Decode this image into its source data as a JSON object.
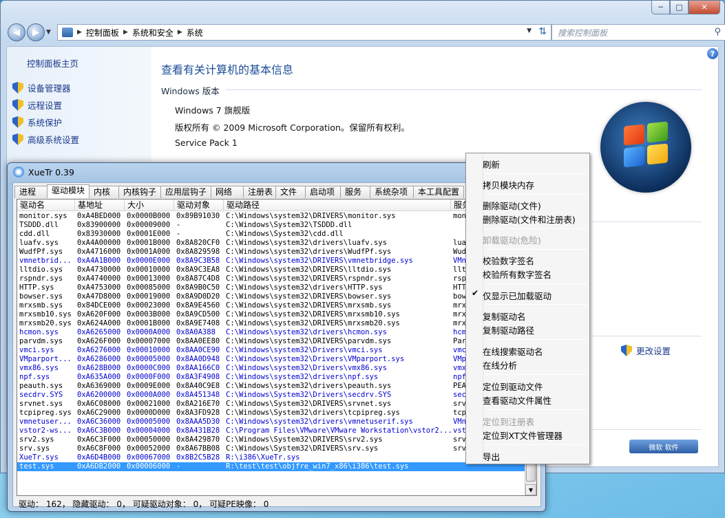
{
  "control_panel": {
    "address": {
      "crumbs": [
        "控制面板",
        "系统和安全",
        "系统"
      ]
    },
    "search_placeholder": "搜索控制面板",
    "sidebar": {
      "home": "控制面板主页",
      "items": [
        "设备管理器",
        "远程设置",
        "系统保护",
        "高级系统设置"
      ]
    },
    "title": "查看有关计算机的基本信息",
    "edition_heading": "Windows 版本",
    "edition": "Windows 7 旗舰版",
    "copyright": "版权所有 © 2009 Microsoft Corporation。保留所有权利。",
    "service_pack": "Service Pack 1",
    "change_settings": "更改设置",
    "genuine_badge": "微软 软件"
  },
  "xuetr": {
    "title": "XueTr 0.39",
    "tabs": [
      "进程",
      "驱动模块",
      "内核",
      "内核钩子",
      "应用层钩子",
      "网络",
      "注册表",
      "文件",
      "启动项",
      "服务",
      "系统杂项",
      "本工具配置"
    ],
    "active_tab": "驱动模块",
    "columns": [
      "驱动名",
      "基地址",
      "大小",
      "驱动对象",
      "驱动路径",
      "服务"
    ],
    "rows": [
      {
        "name": "monitor.sys",
        "base": "0xA4BED000",
        "size": "0x0000B000",
        "obj": "0x89B91030",
        "path": "C:\\Windows\\system32\\DRIVERS\\monitor.sys",
        "svc": "mon",
        "blue": false
      },
      {
        "name": "TSDDD.dll",
        "base": "0x83900000",
        "size": "0x00009000",
        "obj": "-",
        "path": "C:\\Windows\\System32\\TSDDD.dll",
        "svc": "",
        "blue": false
      },
      {
        "name": "cdd.dll",
        "base": "0x83930000",
        "size": "0x0001E000",
        "obj": "-",
        "path": "C:\\Windows\\System32\\cdd.dll",
        "svc": "",
        "blue": false
      },
      {
        "name": "luafv.sys",
        "base": "0xA4A00000",
        "size": "0x0001B000",
        "obj": "0x8A820CF0",
        "path": "C:\\Windows\\system32\\drivers\\luafv.sys",
        "svc": "lua",
        "blue": false
      },
      {
        "name": "WudfPf.sys",
        "base": "0xA4716000",
        "size": "0x0001A000",
        "obj": "0x8A829598",
        "path": "C:\\Windows\\system32\\drivers\\WudfPf.sys",
        "svc": "Wud",
        "blue": false
      },
      {
        "name": "vmnetbrid...",
        "base": "0xA4A1B000",
        "size": "0x0000E000",
        "obj": "0x8A9C3B58",
        "path": "C:\\Windows\\system32\\DRIVERS\\vmnetbridge.sys",
        "svc": "VMn",
        "blue": true
      },
      {
        "name": "lltdio.sys",
        "base": "0xA4730000",
        "size": "0x00010000",
        "obj": "0x8A9C3EA8",
        "path": "C:\\Windows\\system32\\DRIVERS\\lltdio.sys",
        "svc": "llt",
        "blue": false
      },
      {
        "name": "rspndr.sys",
        "base": "0xA4740000",
        "size": "0x00013000",
        "obj": "0x8A87C4D8",
        "path": "C:\\Windows\\system32\\DRIVERS\\rspndr.sys",
        "svc": "rsp",
        "blue": false
      },
      {
        "name": "HTTP.sys",
        "base": "0xA4753000",
        "size": "0x00085000",
        "obj": "0x8A9B0C50",
        "path": "C:\\Windows\\system32\\drivers\\HTTP.sys",
        "svc": "HTT",
        "blue": false
      },
      {
        "name": "bowser.sys",
        "base": "0xA47D8000",
        "size": "0x00019000",
        "obj": "0x8A9D0D20",
        "path": "C:\\Windows\\system32\\DRIVERS\\bowser.sys",
        "svc": "bow",
        "blue": false
      },
      {
        "name": "mrxsmb.sys",
        "base": "0x84DCE000",
        "size": "0x00023000",
        "obj": "0x8A9E4560",
        "path": "C:\\Windows\\system32\\DRIVERS\\mrxsmb.sys",
        "svc": "mrx",
        "blue": false
      },
      {
        "name": "mrxsmb10.sys",
        "base": "0xA620F000",
        "size": "0x0003B000",
        "obj": "0x8A9CD500",
        "path": "C:\\Windows\\system32\\DRIVERS\\mrxsmb10.sys",
        "svc": "mrx",
        "blue": false
      },
      {
        "name": "mrxsmb20.sys",
        "base": "0xA624A000",
        "size": "0x0001B000",
        "obj": "0x8A9E7408",
        "path": "C:\\Windows\\system32\\DRIVERS\\mrxsmb20.sys",
        "svc": "mrx",
        "blue": false
      },
      {
        "name": "hcmon.sys",
        "base": "0xA6265000",
        "size": "0x0000A000",
        "obj": "0x8A0A388",
        "path": "C:\\Windows\\system32\\drivers\\hcmon.sys",
        "svc": "hcm",
        "blue": true
      },
      {
        "name": "parvdm.sys",
        "base": "0xA626F000",
        "size": "0x00007000",
        "obj": "0x8AA0EE80",
        "path": "C:\\Windows\\system32\\DRIVERS\\parvdm.sys",
        "svc": "Par",
        "blue": false
      },
      {
        "name": "vmci.sys",
        "base": "0xA6276000",
        "size": "0x00010000",
        "obj": "0x8AA0CE90",
        "path": "C:\\Windows\\system32\\Drivers\\vmci.sys",
        "svc": "vmc",
        "blue": true
      },
      {
        "name": "VMparport...",
        "base": "0xA6286000",
        "size": "0x00005000",
        "obj": "0x8AA0D948",
        "path": "C:\\Windows\\system32\\Drivers\\VMparport.sys",
        "svc": "VMp",
        "blue": true
      },
      {
        "name": "vmx86.sys",
        "base": "0xA628B000",
        "size": "0x0000C000",
        "obj": "0x8AA166C0",
        "path": "C:\\Windows\\system32\\Drivers\\vmx86.sys",
        "svc": "vmx",
        "blue": true
      },
      {
        "name": "npf.sys",
        "base": "0xA635A000",
        "size": "0x0000F000",
        "obj": "0x8A3F4908",
        "path": "C:\\Windows\\system32\\drivers\\npf.sys",
        "svc": "npf",
        "blue": true
      },
      {
        "name": "peauth.sys",
        "base": "0xA6369000",
        "size": "0x0009E000",
        "obj": "0x8A40C9E8",
        "path": "C:\\Windows\\system32\\drivers\\peauth.sys",
        "svc": "PEA",
        "blue": false
      },
      {
        "name": "secdrv.SYS",
        "base": "0xA6200000",
        "size": "0x0000A000",
        "obj": "0x8A451348",
        "path": "C:\\Windows\\System32\\Drivers\\secdrv.SYS",
        "svc": "sec",
        "blue": true
      },
      {
        "name": "srvnet.sys",
        "base": "0xA6C08000",
        "size": "0x00021000",
        "obj": "0x8A216E70",
        "path": "C:\\Windows\\System32\\DRIVERS\\srvnet.sys",
        "svc": "srv",
        "blue": false
      },
      {
        "name": "tcpipreg.sys",
        "base": "0xA6C29000",
        "size": "0x0000D000",
        "obj": "0x8A3FD928",
        "path": "C:\\Windows\\System32\\drivers\\tcpipreg.sys",
        "svc": "tcp",
        "blue": false
      },
      {
        "name": "vmnetuser...",
        "base": "0xA6C36000",
        "size": "0x00005000",
        "obj": "0x8AAA5D30",
        "path": "C:\\Windows\\system32\\drivers\\vmnetuserif.sys",
        "svc": "VMn",
        "blue": true
      },
      {
        "name": "vstor2-ws...",
        "base": "0xA6C3B000",
        "size": "0x00004000",
        "obj": "0x8A431B28",
        "path": "C:\\Program Files\\VMware\\VMware Workstation\\vstor2...",
        "svc": "vst",
        "blue": true
      },
      {
        "name": "srv2.sys",
        "base": "0xA6C3F000",
        "size": "0x00050000",
        "obj": "0x8A429870",
        "path": "C:\\Windows\\System32\\DRIVERS\\srv2.sys",
        "svc": "srv",
        "blue": false
      },
      {
        "name": "srv.sys",
        "base": "0xA6C8F000",
        "size": "0x00052000",
        "obj": "0x8A67BB08",
        "path": "C:\\Windows\\System32\\DRIVERS\\srv.sys",
        "svc": "srv",
        "blue": false
      },
      {
        "name": "XueTr.sys",
        "base": "0xA6D4B000",
        "size": "0x00067000",
        "obj": "0x8B2C5B28",
        "path": "R:\\i386\\XueTr.sys",
        "svc": "",
        "blue": true
      },
      {
        "name": "test.sys",
        "base": "0xA6DB2000",
        "size": "0x00006000",
        "obj": "-",
        "path": "R:\\test\\test\\objfre_win7_x86\\i386\\test.sys",
        "svc": "",
        "blue": false,
        "selected": true
      }
    ],
    "status": "驱动： 162， 隐藏驱动： 0， 可疑驱动对象： 0， 可疑PE映像： 0"
  },
  "context_menu": {
    "items": [
      {
        "label": "刷新",
        "enabled": true
      },
      {
        "label": "拷贝模块内存",
        "enabled": true
      },
      {
        "label": "删除驱动(文件)",
        "enabled": true
      },
      {
        "label": "删除驱动(文件和注册表)",
        "enabled": true
      },
      {
        "label": "卸载驱动(危险)",
        "enabled": false
      },
      {
        "label": "校验数字签名",
        "enabled": true
      },
      {
        "label": "校验所有数字签名",
        "enabled": true
      },
      {
        "label": "仅显示已加载驱动",
        "enabled": true,
        "checked": true
      },
      {
        "label": "复制驱动名",
        "enabled": true
      },
      {
        "label": "复制驱动路径",
        "enabled": true
      },
      {
        "label": "在线搜索驱动名",
        "enabled": true
      },
      {
        "label": "在线分析",
        "enabled": true
      },
      {
        "label": "定位到驱动文件",
        "enabled": true
      },
      {
        "label": "查看驱动文件属性",
        "enabled": true
      },
      {
        "label": "定位到注册表",
        "enabled": false
      },
      {
        "label": "定位到XT文件管理器",
        "enabled": true
      },
      {
        "label": "导出",
        "enabled": true
      }
    ]
  }
}
